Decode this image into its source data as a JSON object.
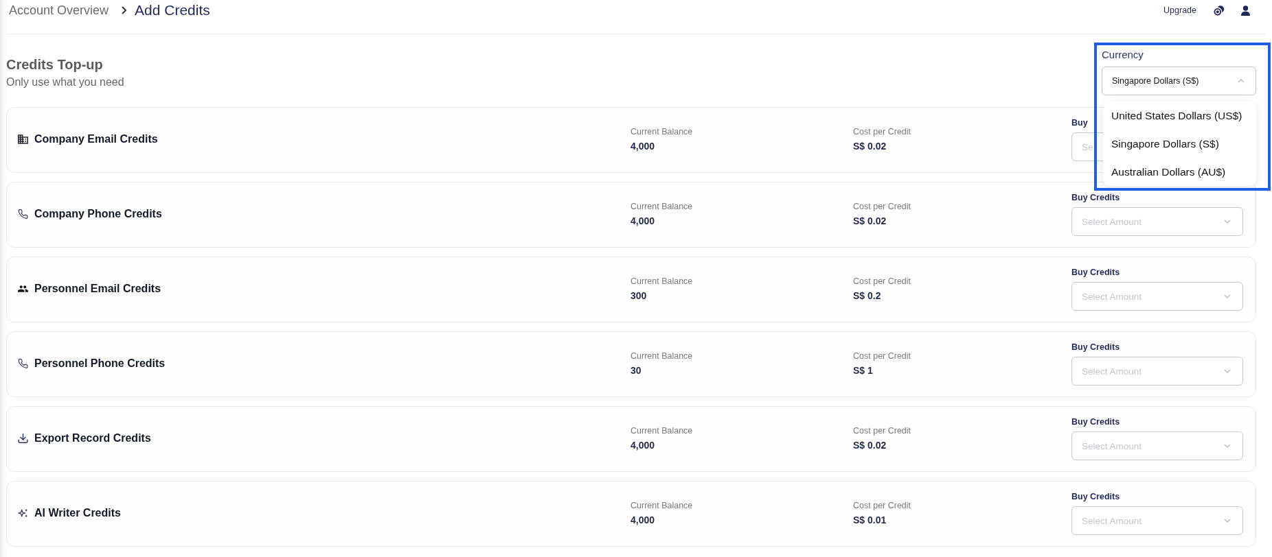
{
  "breadcrumb": {
    "parent": "Account Overview",
    "current": "Add Credits"
  },
  "header": {
    "upgrade": "Upgrade"
  },
  "intro": {
    "title": "Credits Top-up",
    "subtitle": "Only use what you need"
  },
  "currency": {
    "label": "Currency",
    "value": "Singapore Dollars (S$)",
    "expanded": true,
    "options": [
      "United States Dollars (US$)",
      "Singapore Dollars (S$)",
      "Australian Dollars (AU$)"
    ]
  },
  "credits": [
    {
      "name": "Company Email Credits",
      "balance_label": "Current Balance",
      "balance": "4,000",
      "cost_label": "Cost per Credit",
      "cost": "S$ 0.02",
      "buy_label": "Buy",
      "placeholder": "Se"
    },
    {
      "name": "Company Phone Credits",
      "balance_label": "Current Balance",
      "balance": "4,000",
      "cost_label": "Cost per Credit",
      "cost": "S$ 0.02",
      "buy_label": "Buy Credits",
      "placeholder": "Select Amount"
    },
    {
      "name": "Personnel Email Credits",
      "balance_label": "Current Balance",
      "balance": "300",
      "cost_label": "Cost per Credit",
      "cost": "S$ 0.2",
      "buy_label": "Buy Credits",
      "placeholder": "Select Amount"
    },
    {
      "name": "Personnel Phone Credits",
      "balance_label": "Current Balance",
      "balance": "30",
      "cost_label": "Cost per Credit",
      "cost": "S$ 1",
      "buy_label": "Buy Credits",
      "placeholder": "Select Amount"
    },
    {
      "name": "Export Record Credits",
      "balance_label": "Current Balance",
      "balance": "4,000",
      "cost_label": "Cost per Credit",
      "cost": "S$ 0.02",
      "buy_label": "Buy Credits",
      "placeholder": "Select Amount"
    },
    {
      "name": "AI Writer Credits",
      "balance_label": "Current Balance",
      "balance": "4,000",
      "cost_label": "Cost per Credit",
      "cost": "S$ 0.01",
      "buy_label": "Buy Credits",
      "placeholder": "Select Amount"
    }
  ]
}
